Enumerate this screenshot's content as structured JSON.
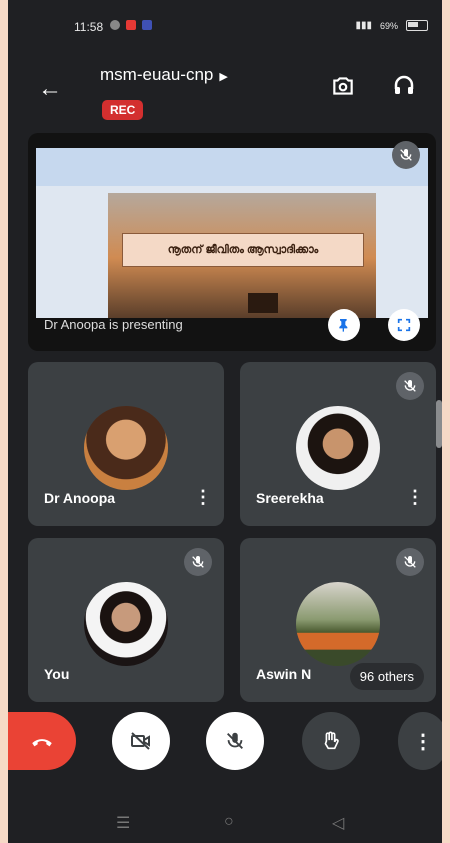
{
  "status_bar": {
    "time": "11:58",
    "battery": "69%"
  },
  "meeting": {
    "code": "msm-euau-cnp",
    "rec_label": "REC"
  },
  "share": {
    "slide_title": "നൂതന് ജീവിതം ആസ്വാദിക്കാം",
    "presenter_label": "Dr Anoopa is presenting"
  },
  "participants": [
    {
      "name": "Dr Anoopa"
    },
    {
      "name": "Sreerekha"
    },
    {
      "name": "You"
    },
    {
      "name": "Aswin N"
    }
  ],
  "others_label": "96 others",
  "colors": {
    "end_call": "#ea4335",
    "rec": "#d32f2f",
    "bg": "#1f2023",
    "tile": "#3c4043"
  },
  "icons": [
    "back-arrow-icon",
    "camera-switch-icon",
    "headphones-icon",
    "pin-icon",
    "fullscreen-icon",
    "mic-off-icon",
    "end-call-icon",
    "video-off-icon",
    "raise-hand-icon",
    "more-vert-icon"
  ]
}
